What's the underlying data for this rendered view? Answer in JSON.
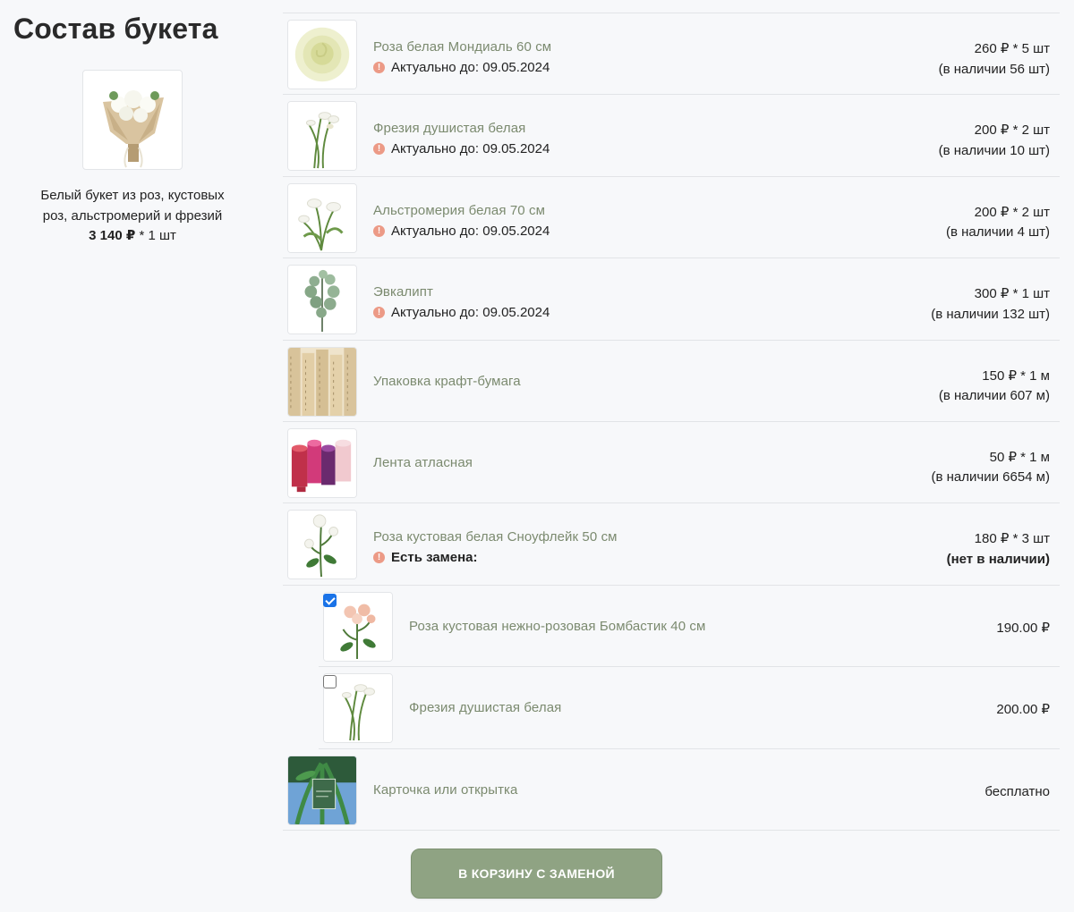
{
  "page": {
    "title": "Состав букета"
  },
  "bouquet": {
    "description": "Белый букет из роз, кустовых роз, альстромерий и фрезий",
    "price": "3 140 ₽",
    "qty": " * 1 шт"
  },
  "items": [
    {
      "name": "Роза белая Мондиаль 60 см",
      "note": "Актуально до: 09.05.2024",
      "price": "260 ₽ * 5 шт",
      "stock": "(в наличии 56 шт)",
      "image": "white-rose-image"
    },
    {
      "name": "Фрезия душистая белая",
      "note": "Актуально до: 09.05.2024",
      "price": "200 ₽ * 2 шт",
      "stock": "(в наличии 10 шт)",
      "image": "freesia-image"
    },
    {
      "name": "Альстромерия белая 70 см",
      "note": "Актуально до: 09.05.2024",
      "price": "200 ₽ * 2 шт",
      "stock": "(в наличии 4 шт)",
      "image": "alstroemeria-image"
    },
    {
      "name": "Эвкалипт",
      "note": "Актуально до: 09.05.2024",
      "price": "300 ₽ * 1 шт",
      "stock": "(в наличии 132 шт)",
      "image": "eucalyptus-image"
    },
    {
      "name": "Упаковка крафт-бумага",
      "price": "150 ₽ * 1 м",
      "stock": "(в наличии 607 м)",
      "image": "kraft-paper-image"
    },
    {
      "name": "Лента атласная",
      "price": "50 ₽ * 1 м",
      "stock": "(в наличии 6654 м)",
      "image": "satin-ribbon-image"
    },
    {
      "name": "Роза кустовая белая Сноуфлейк 50 см",
      "note": "Есть замена:",
      "price": "180 ₽ * 3 шт",
      "stock": "(нет в наличии)",
      "image": "spray-rose-image"
    }
  ],
  "replacements": [
    {
      "name": "Роза кустовая нежно-розовая Бомбастик 40 см",
      "price": "190.00 ₽",
      "checked": true,
      "image": "pink-spray-rose-image"
    },
    {
      "name": "Фрезия душистая белая",
      "price": "200.00 ₽",
      "checked": false,
      "image": "freesia-image"
    }
  ],
  "card": {
    "name": "Карточка или открытка",
    "price": "бесплатно",
    "image": "card-image"
  },
  "cart_button": "В КОРЗИНУ С ЗАМЕНОЙ",
  "colors": {
    "accent": "#8fa383",
    "item_name": "#7b8a6f",
    "warning": "#ec9a86",
    "checkbox": "#1a73e8"
  }
}
